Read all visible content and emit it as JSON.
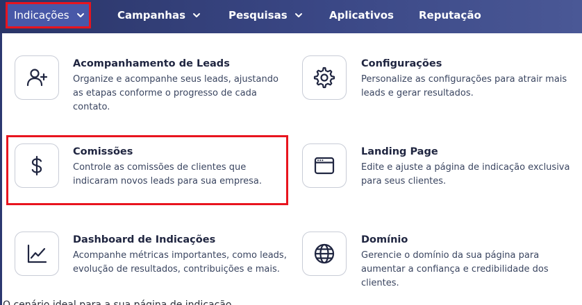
{
  "nav": {
    "items": [
      {
        "label": "Indicações",
        "has_dropdown": true,
        "active": true
      },
      {
        "label": "Campanhas",
        "has_dropdown": true
      },
      {
        "label": "Pesquisas",
        "has_dropdown": true
      },
      {
        "label": "Aplicativos",
        "has_dropdown": false
      },
      {
        "label": "Reputação",
        "has_dropdown": false
      }
    ]
  },
  "menu": {
    "items": [
      {
        "title": "Acompanhamento de Leads",
        "description": "Organize e acompanhe seus leads, ajustando as etapas conforme o progresso de cada contato.",
        "icon": "user-plus-icon"
      },
      {
        "title": "Configurações",
        "description": "Personalize as configurações para atrair mais leads e gerar resultados.",
        "icon": "gear-icon"
      },
      {
        "title": "Comissões",
        "description": "Controle as comissões de clientes que indicaram novos leads para sua empresa.",
        "icon": "dollar-icon",
        "highlighted": true
      },
      {
        "title": "Landing Page",
        "description": "Edite e ajuste a página de indicação exclusiva para seus clientes.",
        "icon": "browser-window-icon"
      },
      {
        "title": "Dashboard de Indicações",
        "description": "Acompanhe métricas importantes, como leads, evolução de resultados, contribuições e mais.",
        "icon": "line-chart-icon"
      },
      {
        "title": "Domínio",
        "description": "Gerencie o domínio da sua página para aumentar a confiança e credibilidade dos clientes.",
        "icon": "globe-icon"
      }
    ]
  },
  "page": {
    "bottom_text": "O cenário ideal para a sua página de indicação"
  },
  "colors": {
    "nav_bg": "#2a3568",
    "active_nav_bg": "#4858a8",
    "highlight": "#e8141e",
    "text_dark": "#1f2540"
  }
}
